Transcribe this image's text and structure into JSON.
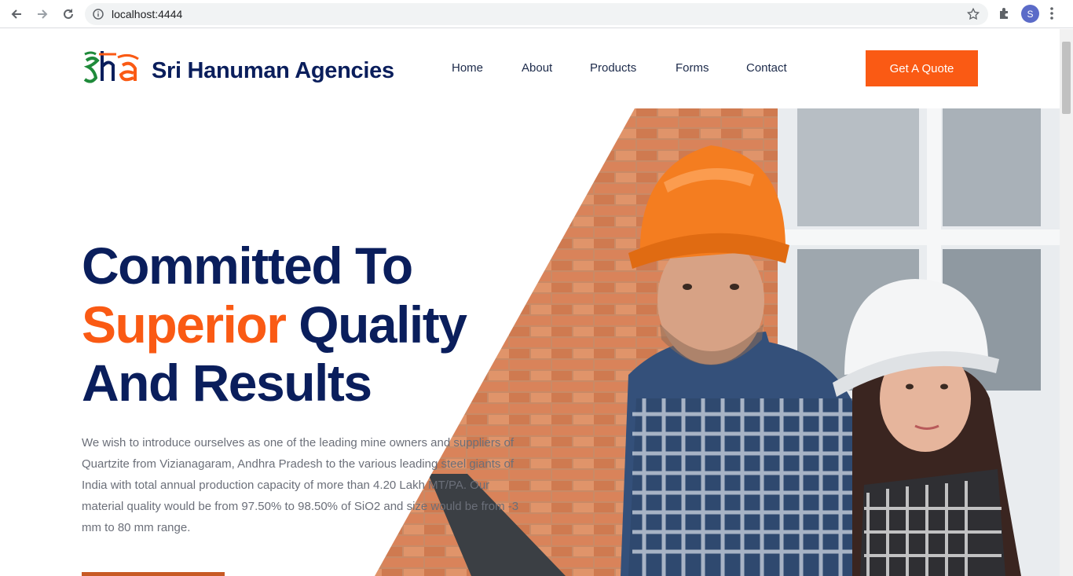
{
  "browser": {
    "url": "localhost:4444",
    "profile_initial": "S"
  },
  "header": {
    "logo_text": "sha",
    "brand_name": "Sri Hanuman Agencies",
    "nav": [
      "Home",
      "About",
      "Products",
      "Forms",
      "Contact"
    ],
    "cta_label": "Get A Quote"
  },
  "hero": {
    "line1": "Committed To",
    "line2_accent": "Superior",
    "line2_rest": "Quality",
    "line3": "And Results",
    "intro": "We wish to introduce ourselves as one of the leading mine owners and suppliers of Quartzite from Vizianagaram, Andhra Pradesh to the various leading steel giants of India with total annual production capacity of more than 4.20 Lakh MT/PA. Our material quality would be from 97.50% to 98.50% of SiO2 and size would be from -3 mm to 80 mm range."
  },
  "colors": {
    "brand_navy": "#0a1e5c",
    "accent_orange": "#fa5a14"
  },
  "icons": [
    "back-arrow-icon",
    "forward-arrow-icon",
    "reload-icon",
    "info-icon",
    "star-icon",
    "puzzle-icon",
    "kebab-menu-icon"
  ]
}
